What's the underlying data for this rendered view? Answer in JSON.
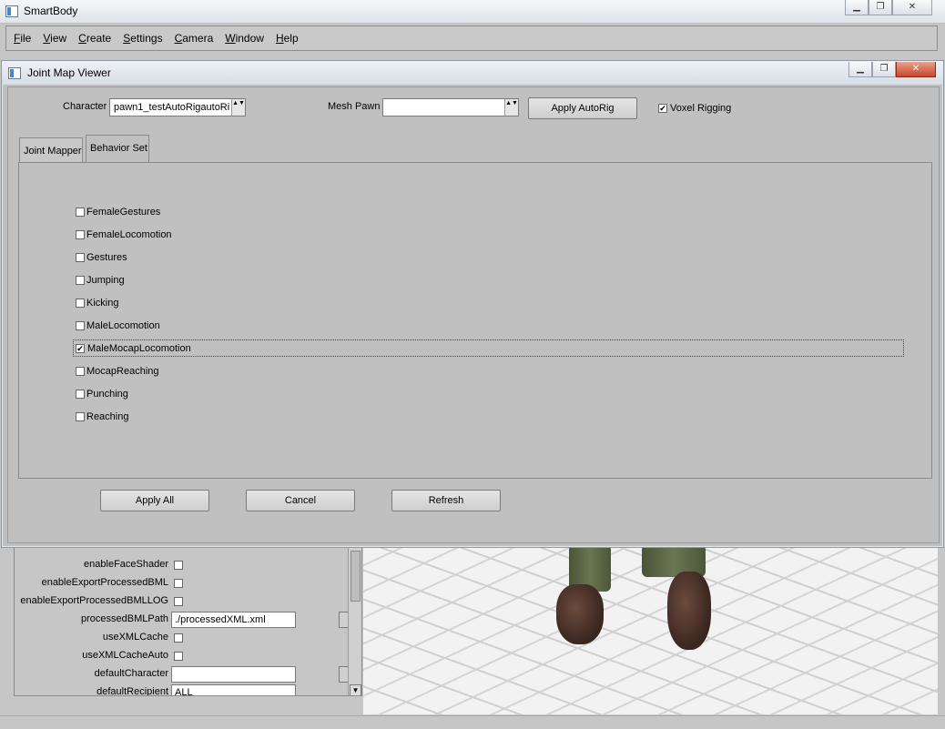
{
  "main_window": {
    "title": "SmartBody",
    "controls": {
      "minimize": "▁",
      "maximize": "❐",
      "close": "✕"
    },
    "menu": [
      {
        "mnemonic": "F",
        "rest": "ile"
      },
      {
        "mnemonic": "V",
        "rest": "iew"
      },
      {
        "mnemonic": "C",
        "rest": "reate"
      },
      {
        "mnemonic": "S",
        "rest": "ettings"
      },
      {
        "mnemonic": "C",
        "rest": "amera"
      },
      {
        "mnemonic": "W",
        "rest": "indow"
      },
      {
        "mnemonic": "H",
        "rest": "elp"
      }
    ]
  },
  "properties": {
    "rows": [
      {
        "label": "enableFaceShader",
        "type": "checkbox"
      },
      {
        "label": "enableExportProcessedBML",
        "type": "checkbox"
      },
      {
        "label": "enableExportProcessedBMLLOG",
        "type": "checkbox"
      },
      {
        "label": "processedBMLPath",
        "type": "text",
        "value": "./processedXML.xml"
      },
      {
        "label": "useXMLCache",
        "type": "checkbox"
      },
      {
        "label": "useXMLCacheAuto",
        "type": "checkbox"
      },
      {
        "label": "defaultCharacter",
        "type": "text",
        "value": ""
      },
      {
        "label": "defaultRecipient",
        "type": "text",
        "value": "ALL"
      }
    ],
    "scroll_down": "▼"
  },
  "dialog": {
    "title": "Joint Map Viewer",
    "controls": {
      "minimize": "▁",
      "maximize": "❐",
      "close": "✕"
    },
    "character_label": "Character",
    "character_value": "pawn1_testAutoRigautoRi",
    "mesh_pawn_label": "Mesh Pawn",
    "mesh_pawn_value": "",
    "apply_autorig": "Apply AutoRig",
    "voxel_rigging_label": "Voxel Rigging",
    "voxel_rigging_checked": true,
    "combo_arrows": "▲▼",
    "tabs": [
      {
        "label": "Joint Mapper",
        "active": false
      },
      {
        "label": "Behavior Set",
        "active": true
      }
    ],
    "behavior_sets": [
      {
        "label": "FemaleGestures",
        "checked": false
      },
      {
        "label": "FemaleLocomotion",
        "checked": false
      },
      {
        "label": "Gestures",
        "checked": false
      },
      {
        "label": "Jumping",
        "checked": false
      },
      {
        "label": "Kicking",
        "checked": false
      },
      {
        "label": "MaleLocomotion",
        "checked": false
      },
      {
        "label": "MaleMocapLocomotion",
        "checked": true
      },
      {
        "label": "MocapReaching",
        "checked": false
      },
      {
        "label": "Punching",
        "checked": false
      },
      {
        "label": "Reaching",
        "checked": false
      }
    ],
    "check_mark": "✔",
    "buttons": {
      "apply_all": "Apply All",
      "cancel": "Cancel",
      "refresh": "Refresh"
    }
  }
}
